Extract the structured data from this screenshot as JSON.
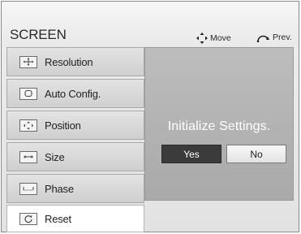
{
  "header": {
    "title": "SCREEN",
    "move_hint": "Move",
    "prev_hint": "Prev."
  },
  "menu": {
    "items": [
      {
        "label": "Resolution",
        "icon": "resolution-icon"
      },
      {
        "label": "Auto Config.",
        "icon": "auto-config-icon"
      },
      {
        "label": "Position",
        "icon": "position-icon"
      },
      {
        "label": "Size",
        "icon": "size-icon"
      },
      {
        "label": "Phase",
        "icon": "phase-icon"
      },
      {
        "label": "Reset",
        "icon": "reset-icon"
      }
    ],
    "selected": "Reset"
  },
  "dialog": {
    "message": "Initialize Settings.",
    "yes_label": "Yes",
    "no_label": "No"
  }
}
